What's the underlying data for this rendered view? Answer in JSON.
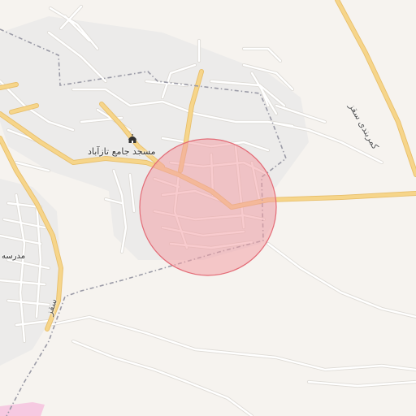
{
  "map": {
    "poi": {
      "mosque_label": "مسجد جامع تازآباد",
      "school_label": "مدرسه ا",
      "mosque_icon": "mosque-icon"
    },
    "roads": {
      "highway_ne_label": "کمربندی سقز",
      "road_west_label": "سقز"
    },
    "colors": {
      "land": "#f6f3ef",
      "built_area": "#ecebea",
      "primary_road": "#f6d58a",
      "primary_road_casing": "#e8bf6b",
      "minor_road": "#ffffff",
      "minor_road_casing": "#dedbd6",
      "boundary": "#9a9aa6",
      "search_circle_fill": "#f2a0a6",
      "search_circle_stroke": "#e36b76",
      "pink_area": "#f6c9e1"
    }
  }
}
